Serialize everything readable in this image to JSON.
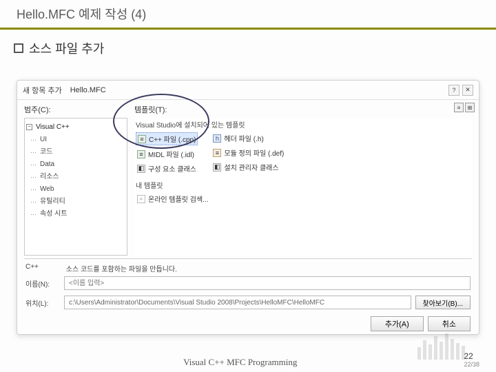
{
  "slide": {
    "title": "Hello.MFC 예제 작성 (4)",
    "bullet": "소스 파일 추가",
    "footer_center": "Visual C++  MFC Programming",
    "page": "22",
    "page_sub": "22/38"
  },
  "dialog": {
    "header_left": "새 항목 추가",
    "header_project": "Hello.MFC",
    "help_glyph": "?",
    "close_glyph": "✕",
    "category_label": "범주(C):",
    "template_label": "템플릿(T):",
    "sort_label": "",
    "sort_icon_list": "≡",
    "sort_icon_grid": "⊞",
    "tree": {
      "root": "Visual C++",
      "items": [
        "UI",
        "코드",
        "Data",
        "리소스",
        "Web",
        "유틸리티",
        "속성 시트"
      ]
    },
    "templates": {
      "heading_installed": "Visual Studio에 설치되어 있는 템플릿",
      "heading_my": "내 템플릿",
      "col1": [
        {
          "icon": "cpp",
          "label": "C++ 파일 (.cpp)",
          "selected": true
        },
        {
          "icon": "cpp",
          "label": "MIDL 파일 (.idl)"
        },
        {
          "icon": "cls",
          "label": "구성 요소 클래스"
        }
      ],
      "col2": [
        {
          "icon": "h",
          "label": "헤더 파일 (.h)"
        },
        {
          "icon": "def",
          "label": "모듈 정의 파일 (.def)"
        },
        {
          "icon": "cls",
          "label": "설치 관리자 클래스"
        }
      ],
      "online": "온라인 템플릿 검색..."
    },
    "description": {
      "label": "C++",
      "text": "소스 코드를 포함하는 파일을 만듭니다."
    },
    "name": {
      "label": "이름(N):",
      "placeholder": "<이름 입력>"
    },
    "location": {
      "label": "위치(L):",
      "value": "c:\\Users\\Administrator\\Documents\\Visual Studio 2008\\Projects\\HelloMFC\\HelloMFC",
      "browse": "찾아보기(B)..."
    },
    "buttons": {
      "add": "추가(A)",
      "cancel": "취소"
    }
  }
}
